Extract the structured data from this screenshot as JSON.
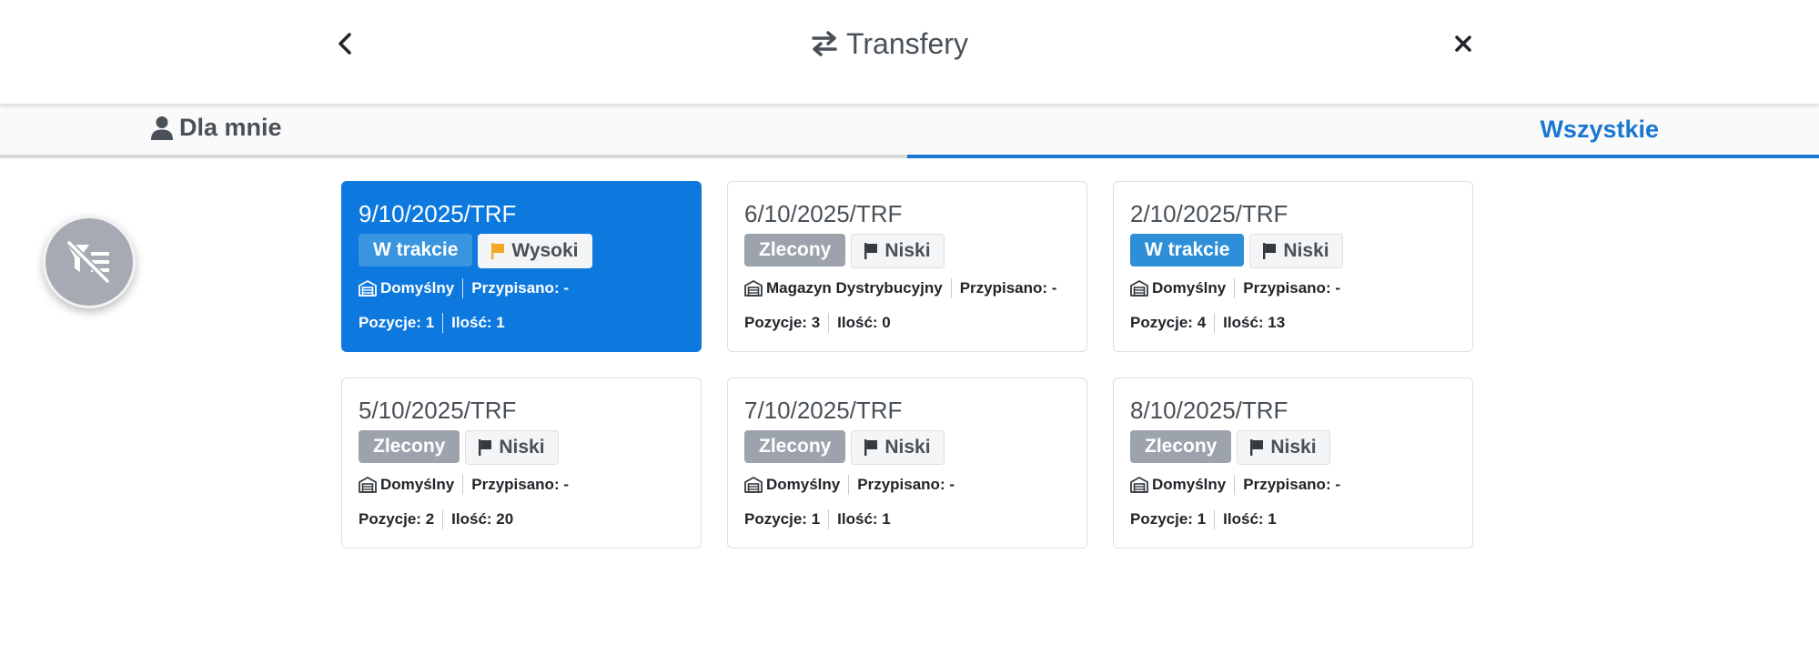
{
  "header": {
    "title": "Transfery",
    "back_icon": "chevron-left-icon",
    "close_icon": "close-icon",
    "title_icon": "transfer-arrows-icon"
  },
  "tabs": [
    {
      "label": "Dla mnie",
      "icon": "user-icon",
      "active": false
    },
    {
      "label": "Wszystkie",
      "active": true
    }
  ],
  "fab": {
    "icon": "filter-off-icon"
  },
  "colors": {
    "accent": "#1976d2",
    "active_card": "#0d78de",
    "status_gray": "#9ca3ad",
    "status_blue": "#2e8fd8",
    "priority_high_flag": "#f5a623"
  },
  "cards": [
    {
      "number": "9/10/2025/TRF",
      "status": "W trakcie",
      "priority": "Wysoki",
      "warehouse": "Domyślny",
      "assigned": "Przypisano: -",
      "positions": "Pozycje: 1",
      "quantity": "Ilość: 1",
      "active": true
    },
    {
      "number": "6/10/2025/TRF",
      "status": "Zlecony",
      "priority": "Niski",
      "warehouse": "Magazyn Dystrybucyjny",
      "assigned": "Przypisano: -",
      "positions": "Pozycje: 3",
      "quantity": "Ilość: 0",
      "active": false
    },
    {
      "number": "2/10/2025/TRF",
      "status": "W trakcie",
      "priority": "Niski",
      "warehouse": "Domyślny",
      "assigned": "Przypisano: -",
      "positions": "Pozycje: 4",
      "quantity": "Ilość: 13",
      "active": false
    },
    {
      "number": "5/10/2025/TRF",
      "status": "Zlecony",
      "priority": "Niski",
      "warehouse": "Domyślny",
      "assigned": "Przypisano: -",
      "positions": "Pozycje: 2",
      "quantity": "Ilość: 20",
      "active": false
    },
    {
      "number": "7/10/2025/TRF",
      "status": "Zlecony",
      "priority": "Niski",
      "warehouse": "Domyślny",
      "assigned": "Przypisano: -",
      "positions": "Pozycje: 1",
      "quantity": "Ilość: 1",
      "active": false
    },
    {
      "number": "8/10/2025/TRF",
      "status": "Zlecony",
      "priority": "Niski",
      "warehouse": "Domyślny",
      "assigned": "Przypisano: -",
      "positions": "Pozycje: 1",
      "quantity": "Ilość: 1",
      "active": false
    }
  ]
}
